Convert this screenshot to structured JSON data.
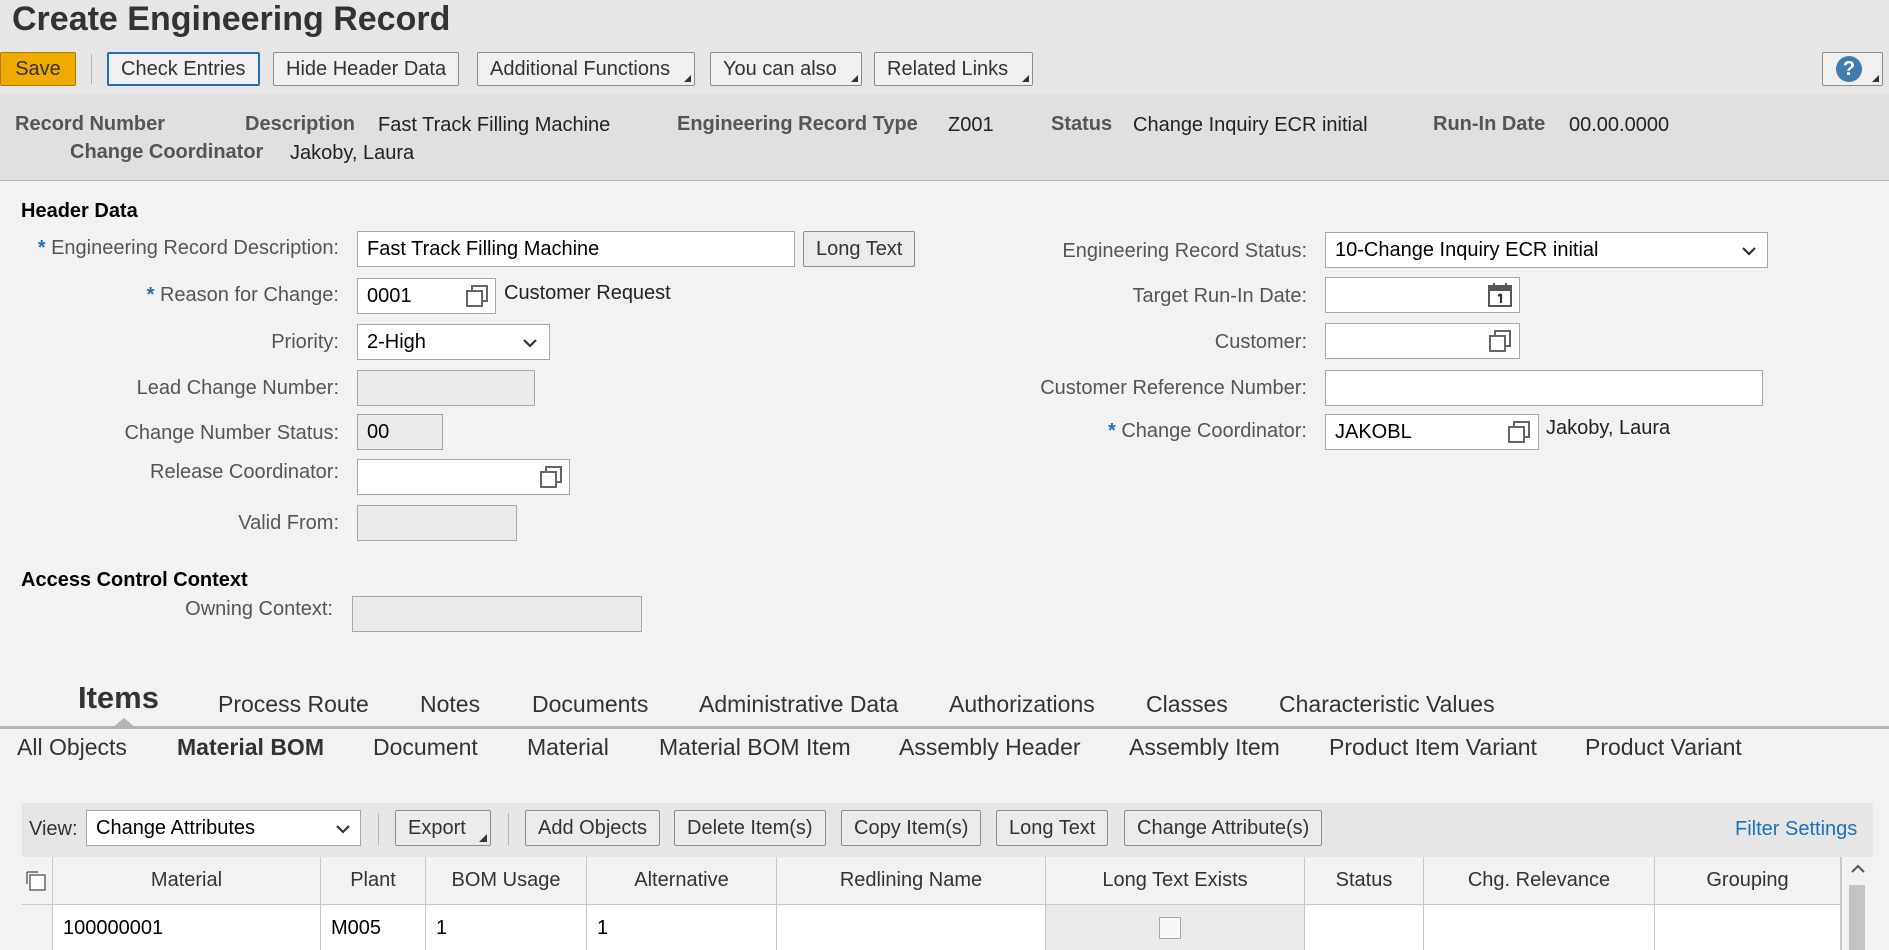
{
  "title": "Create Engineering Record",
  "toolbar": {
    "save": "Save",
    "check_entries": "Check Entries",
    "hide_header": "Hide Header Data",
    "additional_functions": "Additional Functions",
    "you_can_also": "You can also",
    "related_links": "Related Links",
    "help": "?"
  },
  "summary": {
    "record_number_label": "Record Number",
    "description_label": "Description",
    "description_value": "Fast Track Filling Machine",
    "type_label": "Engineering Record Type",
    "type_value": "Z001",
    "status_label": "Status",
    "status_value": "Change Inquiry ECR initial",
    "runin_label": "Run-In Date",
    "runin_value": "00.00.0000",
    "coordinator_label": "Change Coordinator",
    "coordinator_value": "Jakoby, Laura"
  },
  "header_data": {
    "title": "Header Data",
    "description_label": "Engineering Record Description:",
    "description_value": "Fast Track Filling Machine",
    "long_text": "Long Text",
    "reason_label": "Reason for Change:",
    "reason_value": "0001",
    "reason_text": "Customer Request",
    "priority_label": "Priority:",
    "priority_value": "2-High",
    "lead_change_label": "Lead Change Number:",
    "lead_change_value": "",
    "change_status_label": "Change Number Status:",
    "change_status_value": "00",
    "release_coord_label": "Release Coordinator:",
    "release_coord_value": "",
    "valid_from_label": "Valid From:",
    "valid_from_value": "",
    "record_status_label": "Engineering Record Status:",
    "record_status_value": "10-Change Inquiry ECR initial",
    "target_runin_label": "Target Run-In Date:",
    "target_runin_value": "",
    "customer_label": "Customer:",
    "customer_value": "",
    "cust_ref_label": "Customer Reference Number:",
    "cust_ref_value": "",
    "change_coord_label": "Change Coordinator:",
    "change_coord_value": "JAKOBL",
    "change_coord_name": "Jakoby, Laura",
    "required_marker": "*"
  },
  "access_control": {
    "title": "Access Control Context",
    "owning_label": "Owning Context:",
    "owning_value": ""
  },
  "tabs": [
    "Items",
    "Process Route",
    "Notes",
    "Documents",
    "Administrative Data",
    "Authorizations",
    "Classes",
    "Characteristic Values"
  ],
  "subtabs": [
    "All Objects",
    "Material BOM",
    "Document",
    "Material",
    "Material BOM Item",
    "Assembly Header",
    "Assembly Item",
    "Product Item Variant",
    "Product Variant"
  ],
  "table_toolbar": {
    "view_label": "View:",
    "view_value": "Change Attributes",
    "export": "Export",
    "add_objects": "Add Objects",
    "delete_items": "Delete Item(s)",
    "copy_items": "Copy Item(s)",
    "long_text": "Long Text",
    "change_attributes": "Change Attribute(s)",
    "filter_settings": "Filter Settings"
  },
  "table": {
    "columns": [
      "Material",
      "Plant",
      "BOM Usage",
      "Alternative",
      "Redlining Name",
      "Long Text Exists",
      "Status",
      "Chg. Relevance",
      "Grouping"
    ],
    "rows": [
      [
        "100000001",
        "M005",
        "1",
        "1",
        "",
        "",
        "",
        "",
        ""
      ]
    ]
  },
  "colors": {
    "save_button": "#f0ab00",
    "focus_border": "#1a72bb",
    "required_star": "#1a72bb",
    "link": "#1a72bb"
  }
}
